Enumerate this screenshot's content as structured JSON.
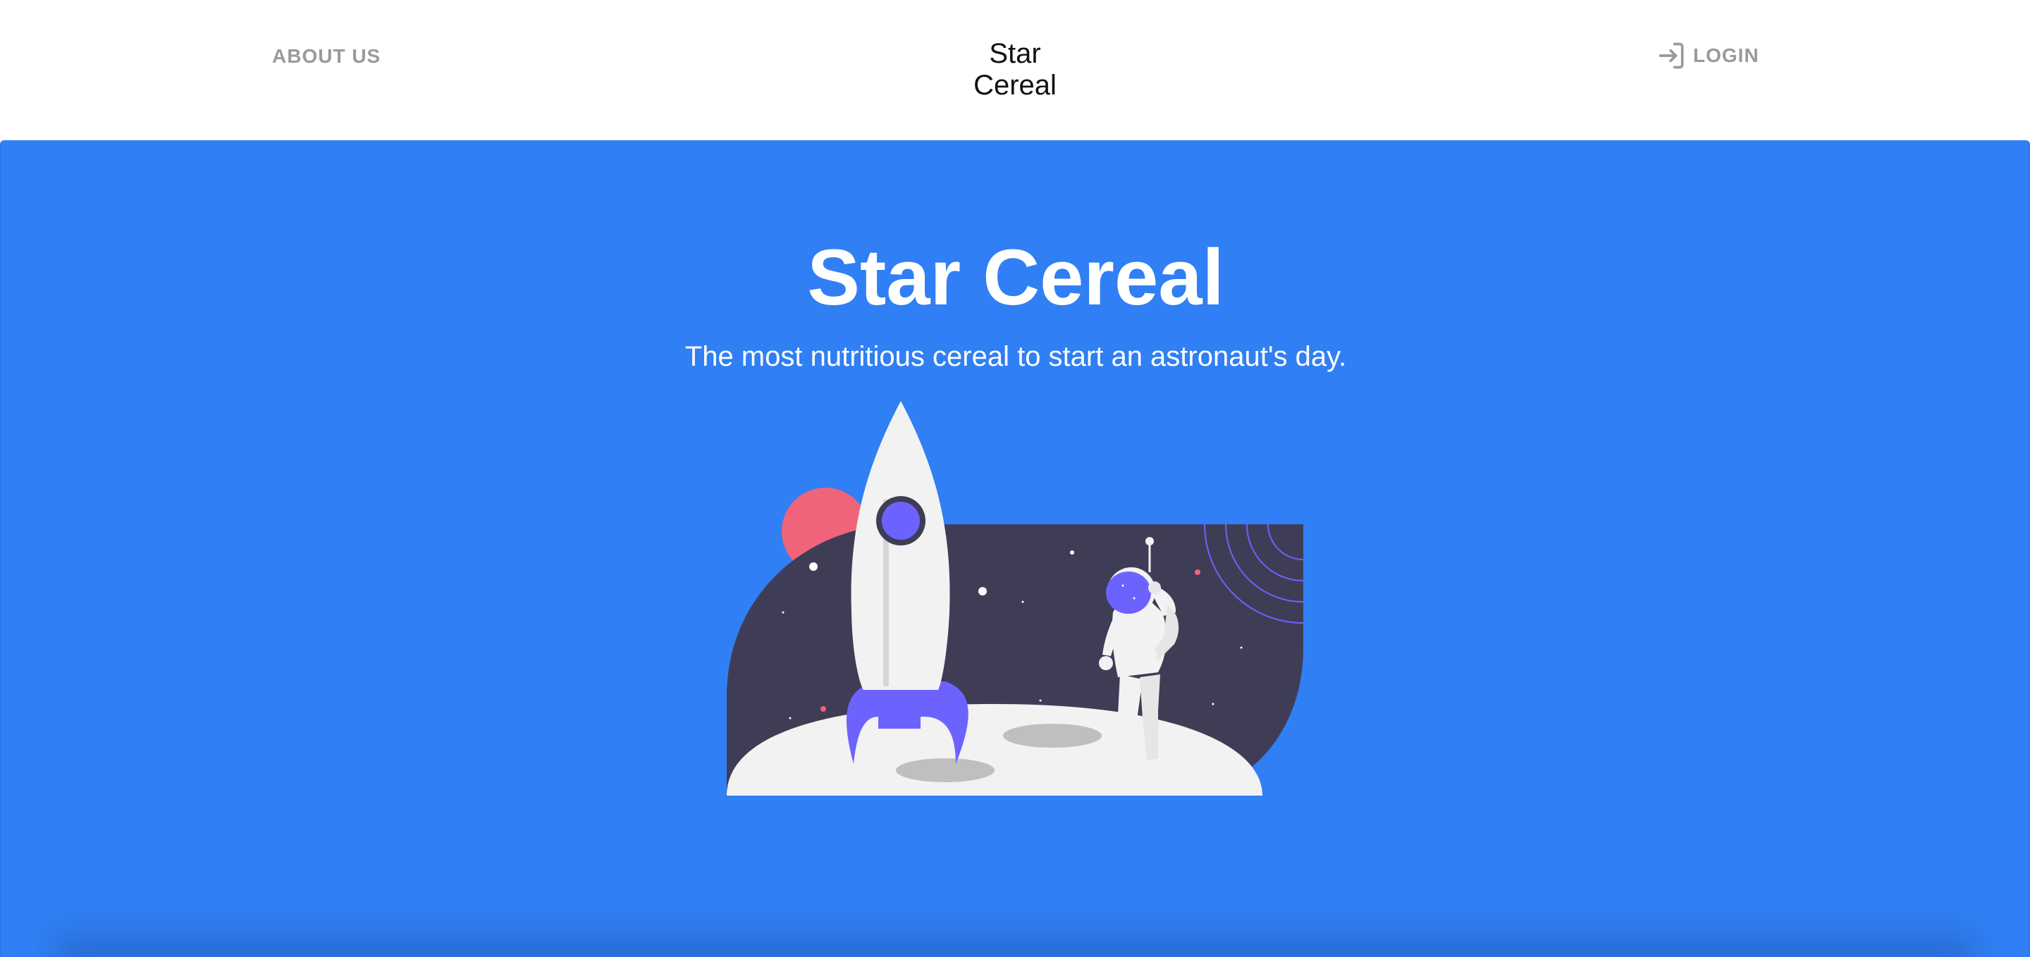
{
  "header": {
    "about_label": "ABOUT US",
    "brand": "Star Cereal",
    "login_label": "LOGIN",
    "login_icon": "login-arrow-icon"
  },
  "hero": {
    "title": "Star Cereal",
    "subtitle": "The most nutritious cereal to start an astronaut's day.",
    "illustration": "astronaut-and-rocket-on-moon",
    "background_color": "#307ff4"
  },
  "colors": {
    "nav_text": "#9a9a9a",
    "brand_text": "#111111",
    "space": "#3f3d56",
    "accent_purple": "#6c63ff",
    "accent_pink": "#f0647b",
    "moon": "#f2f2f2"
  }
}
